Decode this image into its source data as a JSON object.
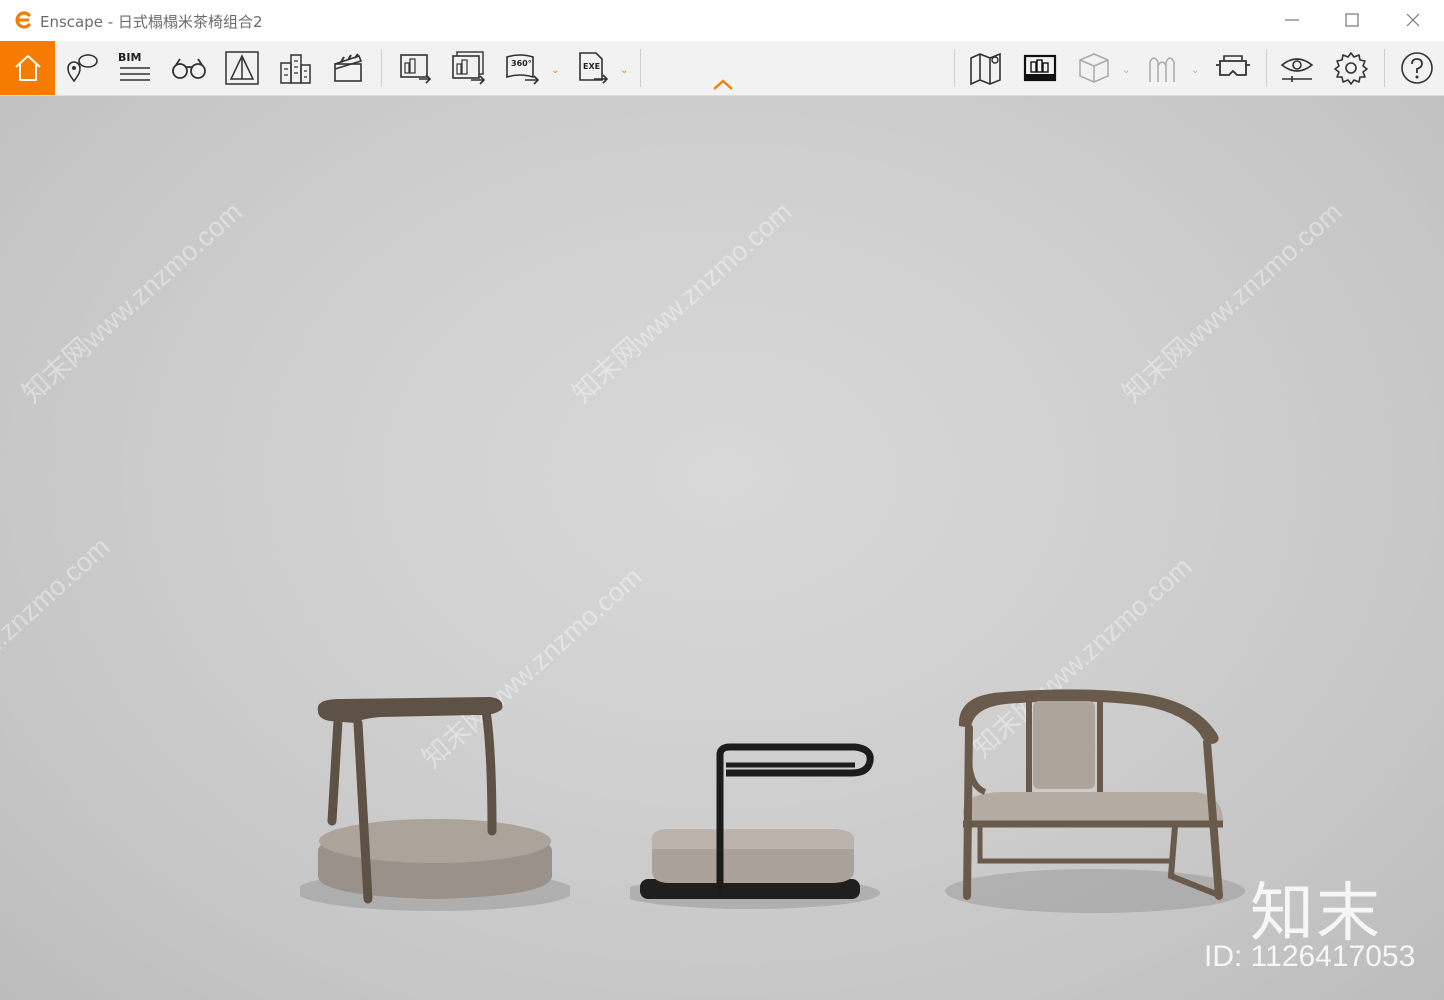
{
  "window": {
    "app_name": "Enscape",
    "title": "Enscape - 日式榻榻米茶椅组合2"
  },
  "toolbar": {
    "left_tools": [
      {
        "name": "home",
        "icon": "home-icon"
      },
      {
        "name": "location",
        "icon": "location-chat-icon"
      },
      {
        "name": "bim",
        "label": "BIM",
        "icon": "bim-icon"
      },
      {
        "name": "views",
        "icon": "binoculars-icon"
      },
      {
        "name": "sketch",
        "icon": "pyramid-icon"
      },
      {
        "name": "buildings",
        "icon": "buildings-icon"
      },
      {
        "name": "video",
        "icon": "clapperboard-icon"
      }
    ],
    "export_tools": [
      {
        "name": "screenshot",
        "icon": "export-image-icon"
      },
      {
        "name": "batch",
        "icon": "batch-export-icon"
      },
      {
        "name": "panorama",
        "label": "360°",
        "icon": "panorama-export-icon"
      },
      {
        "name": "exe",
        "label": "EXE",
        "icon": "exe-export-icon"
      }
    ],
    "right_tools": [
      {
        "name": "map",
        "icon": "map-icon"
      },
      {
        "name": "assets",
        "icon": "asset-library-icon"
      },
      {
        "name": "cube",
        "icon": "cube-icon"
      },
      {
        "name": "people",
        "icon": "people-icon"
      },
      {
        "name": "vr",
        "icon": "vr-headset-icon"
      },
      {
        "name": "visual",
        "icon": "eye-settings-icon"
      },
      {
        "name": "settings",
        "icon": "gear-icon"
      },
      {
        "name": "help",
        "icon": "help-icon"
      }
    ],
    "accent": "#f57c00"
  },
  "viewport": {
    "watermark_text": "知末网www.znzmo.com",
    "brand": "知末",
    "image_id": "ID: 1126417053"
  }
}
